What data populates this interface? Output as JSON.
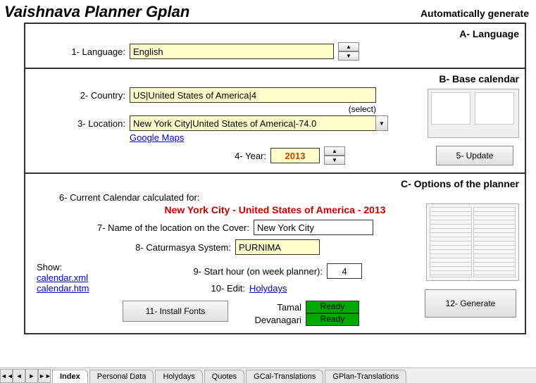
{
  "header": {
    "title": "Vaishnava Planner Gplan",
    "subtitle": "Automatically generate"
  },
  "sectionA": {
    "title": "A- Language",
    "languageLabel": "1- Language:",
    "languageValue": "English"
  },
  "sectionB": {
    "title": "B- Base calendar",
    "countryLabel": "2- Country:",
    "countryValue": "US|United States of America|4",
    "selectHint": "(select)",
    "locationLabel": "3- Location:",
    "locationValue": "New York City|United States of America|-74.0",
    "mapsLink": "Google Maps",
    "yearLabel": "4- Year:",
    "yearValue": "2013",
    "updateBtn": "5- Update"
  },
  "sectionC": {
    "title": "C- Options of the planner",
    "calcLabel": "6- Current Calendar calculated for:",
    "calcValue": "New York City - United States of America - 2013",
    "coverLabel": "7- Name of the location on the Cover:",
    "coverValue": "New York City",
    "caturLabel": "8- Caturmasya System:",
    "caturValue": "PURNIMA",
    "showLabel": "Show:",
    "showLinks": [
      "calendar.xml",
      "calendar.htm"
    ],
    "startLabel": "9- Start hour (on week planner):",
    "startValue": "4",
    "editLabel": "10- Edit:",
    "editLink": "Holydays",
    "installBtn": "11- Install Fonts",
    "tamalLabel": "Tamal",
    "tamalStatus": "Ready",
    "devLabel": "Devanagari",
    "devStatus": "Ready",
    "generateBtn": "12- Generate"
  },
  "tabs": [
    "Index",
    "Personal Data",
    "Holydays",
    "Quotes",
    "GCal-Translations",
    "GPlan-Translations"
  ]
}
